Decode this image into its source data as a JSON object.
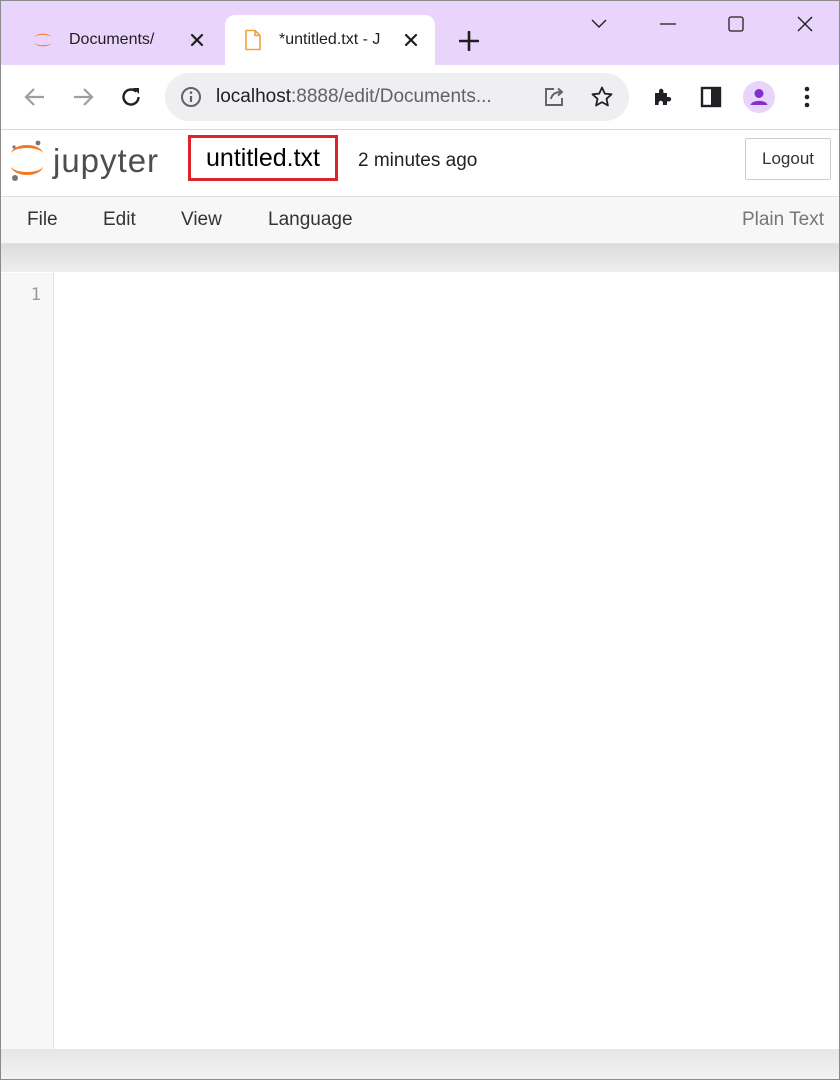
{
  "browser": {
    "tabs": [
      {
        "title": "Documents/",
        "active": false,
        "icon": "jupyter-logo-icon"
      },
      {
        "title": "*untitled.txt - J",
        "active": true,
        "icon": "file-icon"
      }
    ],
    "url_host": "localhost",
    "url_rest": ":8888/edit/Documents...",
    "accent": "#e9d5fb"
  },
  "header": {
    "logo_text": "jupyter",
    "filename": "untitled.txt",
    "last_saved": "2 minutes ago",
    "logout_label": "Logout"
  },
  "menu": {
    "items": [
      "File",
      "Edit",
      "View",
      "Language"
    ],
    "mode": "Plain Text"
  },
  "editor": {
    "line_numbers": [
      "1"
    ]
  },
  "colors": {
    "jupyter_orange": "#f37726",
    "highlight_red": "#e0232b",
    "profile_purple": "#8430ce"
  }
}
